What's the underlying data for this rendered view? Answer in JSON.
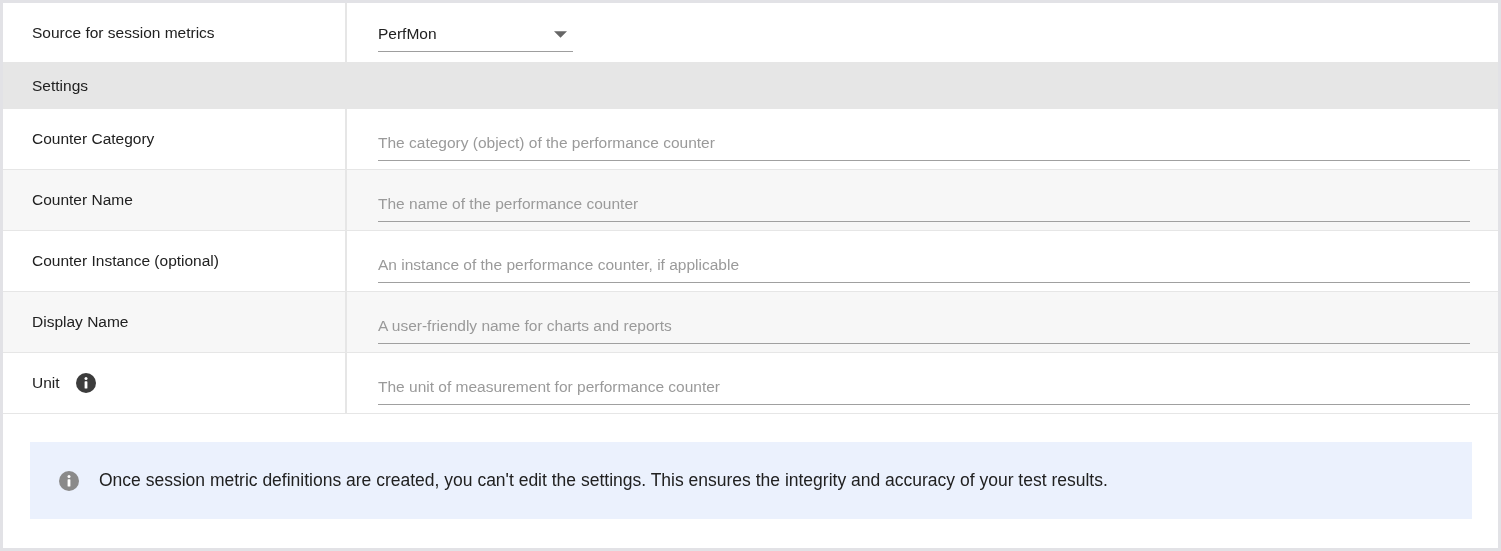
{
  "source": {
    "label": "Source for session metrics",
    "value": "PerfMon"
  },
  "section": {
    "title": "Settings"
  },
  "fields": [
    {
      "label": "Counter Category",
      "placeholder": "The category (object) of the performance counter",
      "info": false
    },
    {
      "label": "Counter Name",
      "placeholder": "The name of the performance counter",
      "info": false
    },
    {
      "label": "Counter Instance (optional)",
      "placeholder": "An instance of the performance counter, if applicable",
      "info": false
    },
    {
      "label": "Display Name",
      "placeholder": "A user-friendly name for charts and reports",
      "info": false
    },
    {
      "label": "Unit",
      "placeholder": "The unit of measurement for performance counter",
      "info": true
    }
  ],
  "notice": {
    "text": "Once session metric definitions are created, you can't edit the settings. This ensures the integrity and accuracy of your test results."
  }
}
